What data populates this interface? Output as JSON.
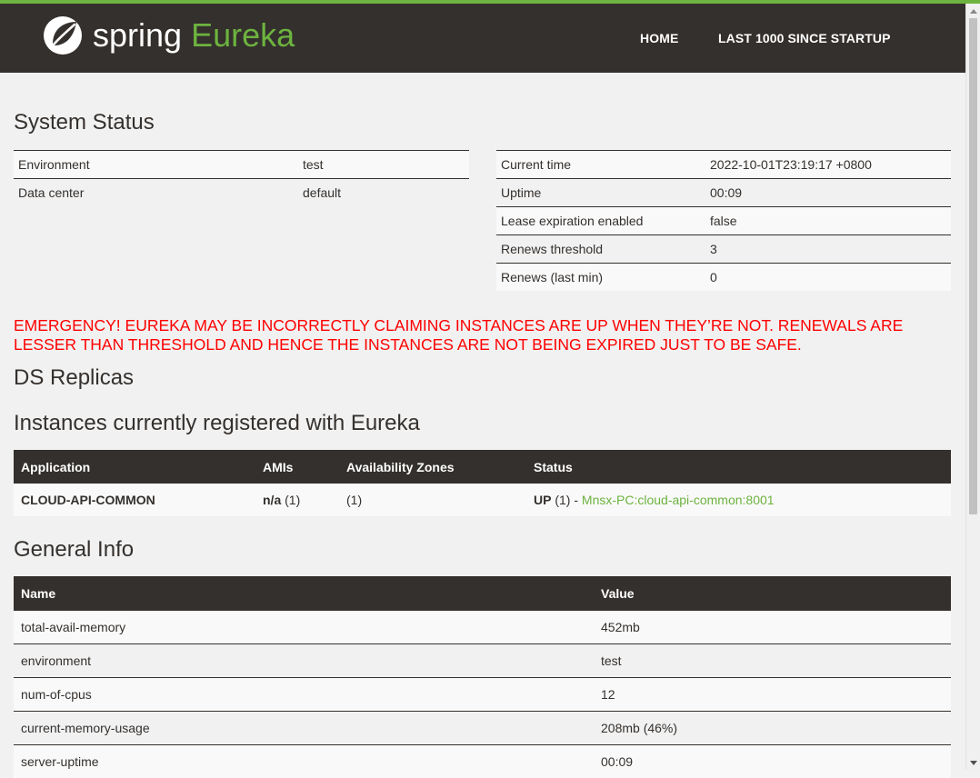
{
  "brand": {
    "spring": "spring",
    "eureka": "Eureka"
  },
  "colors": {
    "accent": "#6db33f",
    "dark": "#34302d",
    "emergency": "#ff0000"
  },
  "nav": {
    "home": "HOME",
    "last": "LAST 1000 SINCE STARTUP"
  },
  "system_status": {
    "title": "System Status",
    "left": [
      {
        "key": "Environment",
        "value": "test"
      },
      {
        "key": "Data center",
        "value": "default"
      }
    ],
    "right": [
      {
        "key": "Current time",
        "value": "2022-10-01T23:19:17 +0800"
      },
      {
        "key": "Uptime",
        "value": "00:09"
      },
      {
        "key": "Lease expiration enabled",
        "value": "false"
      },
      {
        "key": "Renews threshold",
        "value": "3"
      },
      {
        "key": "Renews (last min)",
        "value": "0"
      }
    ]
  },
  "emergency": "EMERGENCY! EUREKA MAY BE INCORRECTLY CLAIMING INSTANCES ARE UP WHEN THEY’RE NOT. RENEWALS ARE LESSER THAN THRESHOLD AND HENCE THE INSTANCES ARE NOT BEING EXPIRED JUST TO BE SAFE.",
  "ds_replicas": {
    "title": "DS Replicas"
  },
  "instances": {
    "title": "Instances currently registered with Eureka",
    "headers": [
      "Application",
      "AMIs",
      "Availability Zones",
      "Status"
    ],
    "rows": [
      {
        "application": "CLOUD-API-COMMON",
        "ami_bold": "n/a",
        "ami_count": " (1)",
        "zones": "(1)",
        "status_bold": "UP",
        "status_count": " (1) - ",
        "status_link": "Mnsx-PC:cloud-api-common:8001"
      }
    ]
  },
  "general_info": {
    "title": "General Info",
    "headers": [
      "Name",
      "Value"
    ],
    "rows": [
      {
        "name": "total-avail-memory",
        "value": "452mb"
      },
      {
        "name": "environment",
        "value": "test"
      },
      {
        "name": "num-of-cpus",
        "value": "12"
      },
      {
        "name": "current-memory-usage",
        "value": "208mb (46%)"
      },
      {
        "name": "server-uptime",
        "value": "00:09"
      }
    ]
  }
}
